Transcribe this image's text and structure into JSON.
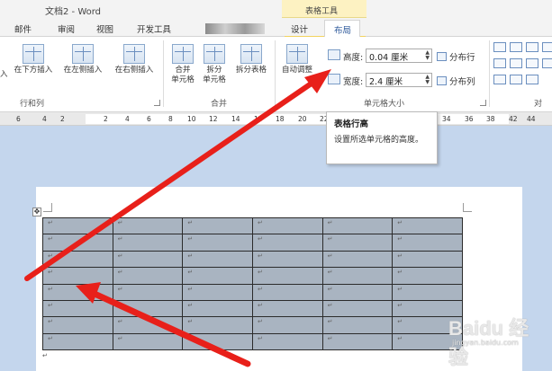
{
  "window": {
    "title": "文档2 - Word",
    "context_tab_group": "表格工具"
  },
  "tabs": {
    "mail": "邮件",
    "review": "审阅",
    "view": "视图",
    "developer": "开发工具",
    "design": "设计",
    "layout": "布局"
  },
  "ribbon": {
    "rows_columns": {
      "insert_below": "在下方插入",
      "insert_left": "在左侧插入",
      "insert_right": "在右侧插入",
      "group_label": "行和列",
      "leading_glyph": "入"
    },
    "merge": {
      "merge_cells_l1": "合并",
      "merge_cells_l2": "单元格",
      "split_cells_l1": "拆分",
      "split_cells_l2": "单元格",
      "split_table": "拆分表格",
      "group_label": "合并"
    },
    "cell_size": {
      "autofit": "自动调整",
      "height_label": "高度:",
      "height_value": "0.04 厘米",
      "width_label": "宽度:",
      "width_value": "2.4 厘米",
      "distribute_rows": "分布行",
      "distribute_cols": "分布列",
      "group_label": "单元格大小"
    },
    "alignment": {
      "group_label_partial": "对"
    }
  },
  "ruler": {
    "labels": [
      "6",
      "4",
      "2",
      "",
      "2",
      "4",
      "6",
      "8",
      "10",
      "12",
      "14",
      "16",
      "18",
      "20",
      "22",
      "",
      "34",
      "36",
      "38",
      "",
      "42",
      "44"
    ]
  },
  "tooltip": {
    "title": "表格行高",
    "description": "设置所选单元格的高度。"
  },
  "document": {
    "table": {
      "rows": 8,
      "cols": 6,
      "cell_mark": "↵"
    },
    "move_handle_glyph": "✥"
  },
  "watermark": {
    "text": "Baidu 经验",
    "sub": "jingyan.baidu.com"
  },
  "colors": {
    "arrow": "#e8201a",
    "table_fill": "#a9b4c1",
    "doc_background": "#c4d6ed",
    "context_tab": "#fdf2c2"
  }
}
